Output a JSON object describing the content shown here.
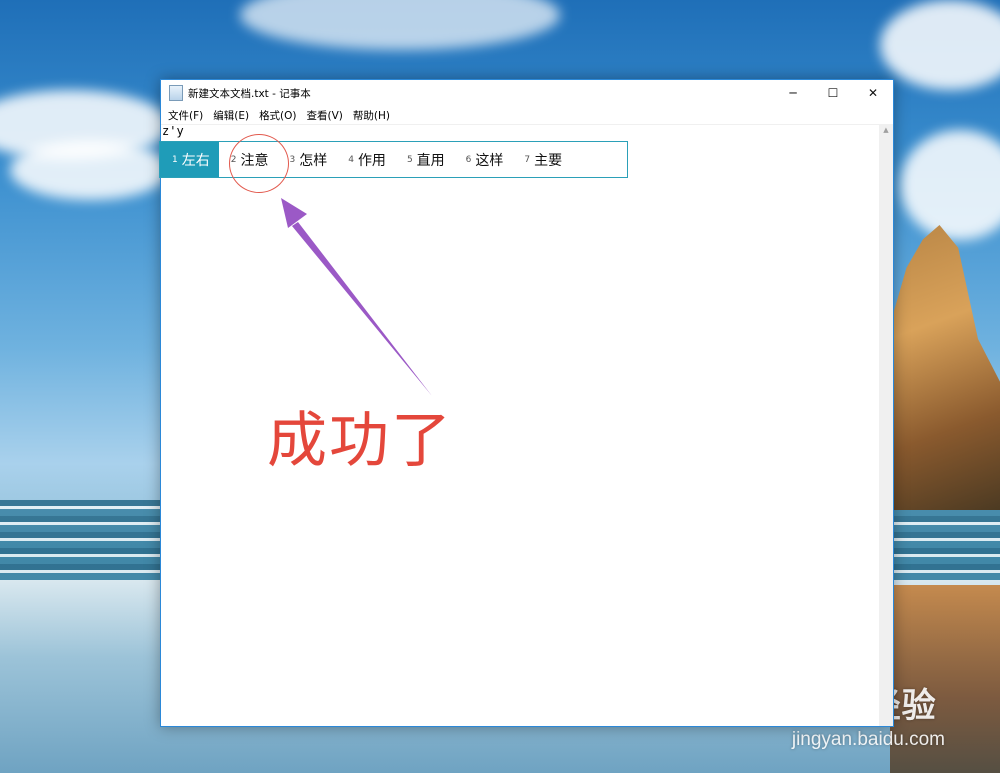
{
  "window": {
    "title": "新建文本文档.txt - 记事本",
    "controls": {
      "minimize": "─",
      "maximize": "☐",
      "close": "✕"
    }
  },
  "menu": [
    "文件(F)",
    "编辑(E)",
    "格式(O)",
    "查看(V)",
    "帮助(H)"
  ],
  "editor": {
    "text": "z'y"
  },
  "ime": {
    "candidates": [
      {
        "num": "1",
        "word": "左右",
        "selected": true
      },
      {
        "num": "2",
        "word": "注意",
        "selected": false
      },
      {
        "num": "3",
        "word": "怎样",
        "selected": false
      },
      {
        "num": "4",
        "word": "作用",
        "selected": false
      },
      {
        "num": "5",
        "word": "直用",
        "selected": false
      },
      {
        "num": "6",
        "word": "这样",
        "selected": false
      },
      {
        "num": "7",
        "word": "主要",
        "selected": false
      }
    ]
  },
  "annotation": {
    "caption": "成功了",
    "ring_color": "#e25a4e",
    "arrow_color": "#9b59c6",
    "caption_color": "#e4473b"
  },
  "watermark": {
    "line1": "Bai 经验",
    "line2": "jingyan.baidu.com"
  },
  "colors": {
    "ime_selected": "#1f9cb8",
    "window_border": "#2b88d8"
  }
}
